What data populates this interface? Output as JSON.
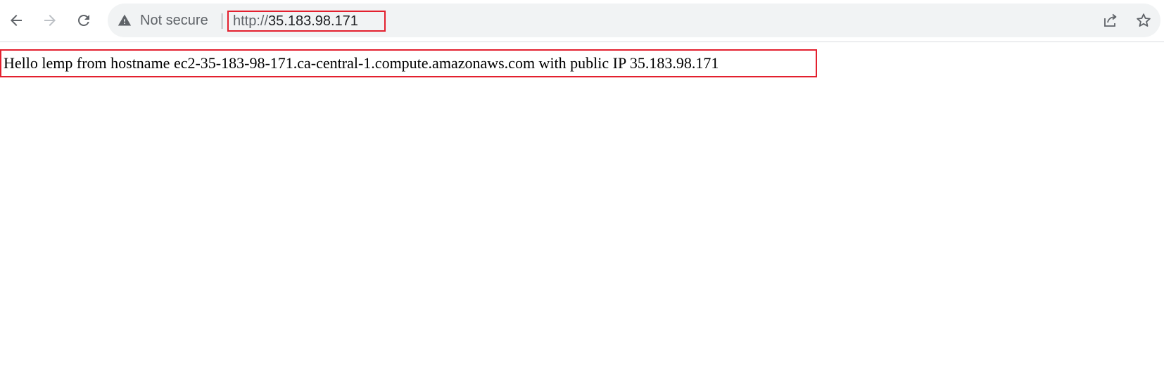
{
  "browser": {
    "security_label": "Not secure",
    "url_scheme": "http://",
    "url_host": "35.183.98.171",
    "icons": {
      "back": "back-arrow-icon",
      "forward": "forward-arrow-icon",
      "reload": "reload-icon",
      "security": "warning-triangle-icon",
      "share": "share-icon",
      "bookmark": "star-icon"
    }
  },
  "page": {
    "text": "Hello lemp from hostname ec2-35-183-98-171.ca-central-1.compute.amazonaws.com with public IP 35.183.98.171"
  },
  "colors": {
    "highlight": "#e3202e",
    "omnibox_bg": "#f1f3f4",
    "icon": "#5f6368"
  }
}
